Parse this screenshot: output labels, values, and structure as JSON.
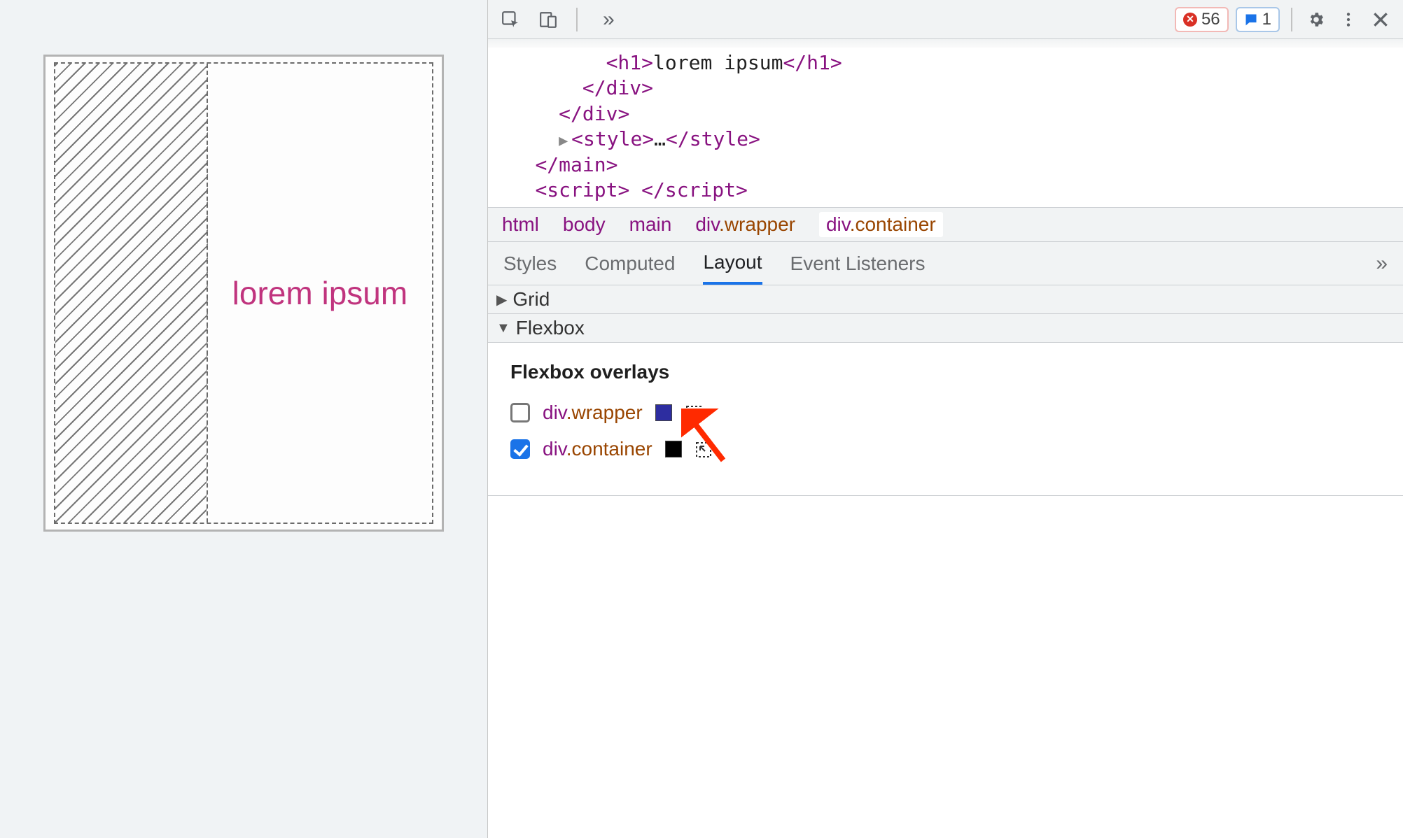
{
  "preview": {
    "text": "lorem ipsum"
  },
  "toolbar": {
    "errors_count": "56",
    "messages_count": "1"
  },
  "code": {
    "line0_pre": "          ",
    "line0_tag_open": "<h1>",
    "line0_text": "lorem ipsum",
    "line0_tag_close": "</h1>",
    "line1_pre": "        ",
    "line1": "</div>",
    "line2_pre": "      ",
    "line2": "</div>",
    "line3_pre": "      ",
    "line3_open": "<style>",
    "line3_mid": "…",
    "line3_close": "</style>",
    "line4_pre": "    ",
    "line4": "</main>",
    "line5_pre": "    ",
    "line5_open": "<script>",
    "line5_mid": " ",
    "line5_close": "</script>"
  },
  "breadcrumb": {
    "items": [
      "html",
      "body",
      "main"
    ],
    "wrapper_tag": "div",
    "wrapper_cls": ".wrapper",
    "container_tag": "div",
    "container_cls": ".container"
  },
  "tabs": {
    "styles": "Styles",
    "computed": "Computed",
    "layout": "Layout",
    "event": "Event Listeners"
  },
  "sections": {
    "grid": "Grid",
    "flexbox": "Flexbox"
  },
  "overlays": {
    "title": "Flexbox overlays",
    "wrapper_tag": "div",
    "wrapper_cls": ".wrapper",
    "container_tag": "div",
    "container_cls": ".container"
  }
}
